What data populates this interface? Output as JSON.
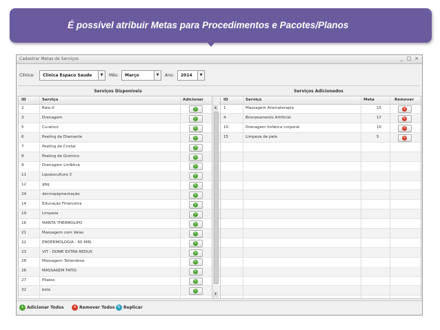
{
  "banner": {
    "title": "É possível atribuir Metas para Procedimentos e Pacotes/Planos"
  },
  "window": {
    "title": "Cadastrar Metas de Serviços",
    "controls": {
      "minimize": "_",
      "maximize": "□",
      "close": "×"
    }
  },
  "filters": {
    "clinica_label": "Clínica:",
    "clinica_value": "Clinica Espaco Saude",
    "mes_label": "Mês:",
    "mes_value": "Março",
    "ano_label": "Ano:",
    "ano_value": "2014"
  },
  "disponiveis": {
    "title": "Serviços Disponíveis",
    "columns": {
      "id": "ID",
      "servico": "Serviço",
      "adicionar": "Adicionar"
    },
    "rows": [
      {
        "id": "2",
        "servico": "Raio-X"
      },
      {
        "id": "3",
        "servico": "Drenagem"
      },
      {
        "id": "5",
        "servico": "Curativo"
      },
      {
        "id": "6",
        "servico": "Peeling de Diamante"
      },
      {
        "id": "7",
        "servico": "Peeling de Cristal"
      },
      {
        "id": "8",
        "servico": "Peeling de Quimico"
      },
      {
        "id": "9",
        "servico": "Drenagem Linfática"
      },
      {
        "id": "11",
        "servico": "Lipoescultura 3"
      },
      {
        "id": "12",
        "servico": "gbg"
      },
      {
        "id": "24",
        "servico": "dermopigmentação"
      },
      {
        "id": "14",
        "servico": "Educação Financeira"
      },
      {
        "id": "19",
        "servico": "Limpeza"
      },
      {
        "id": "16",
        "servico": "MANTA THERMOLIPO"
      },
      {
        "id": "21",
        "servico": "Massagem com Velas"
      },
      {
        "id": "22",
        "servico": "ENDERMOLOGIA - 60 MIN."
      },
      {
        "id": "23",
        "servico": "VIT - DOME EXTRA REDUX"
      },
      {
        "id": "28",
        "servico": "Massagem Tailandesa"
      },
      {
        "id": "26",
        "servico": "MASSAGEM TATIO"
      },
      {
        "id": "27",
        "servico": "Pilates"
      },
      {
        "id": "32",
        "servico": "bola"
      }
    ]
  },
  "adicionados": {
    "title": "Serviços Adicionados",
    "columns": {
      "id": "ID",
      "servico": "Serviço",
      "meta": "Meta",
      "remover": "Remover"
    },
    "rows": [
      {
        "id": "1",
        "servico": "Massagem Aromaterapia",
        "meta": "15"
      },
      {
        "id": "4",
        "servico": "Bronzeamento Artificial",
        "meta": "17"
      },
      {
        "id": "10",
        "servico": "Drenagem linfática corporal",
        "meta": "10"
      },
      {
        "id": "15",
        "servico": "Limpeza de pele",
        "meta": "5"
      }
    ]
  },
  "actions": {
    "adicionar_todos": "Adicionar Todos",
    "remover_todos": "Remover Todos",
    "replicar": "Replicar"
  },
  "colors": {
    "banner": "#6a5a9e",
    "add_green": "#4aa32e",
    "remove_red": "#d43b2a"
  }
}
